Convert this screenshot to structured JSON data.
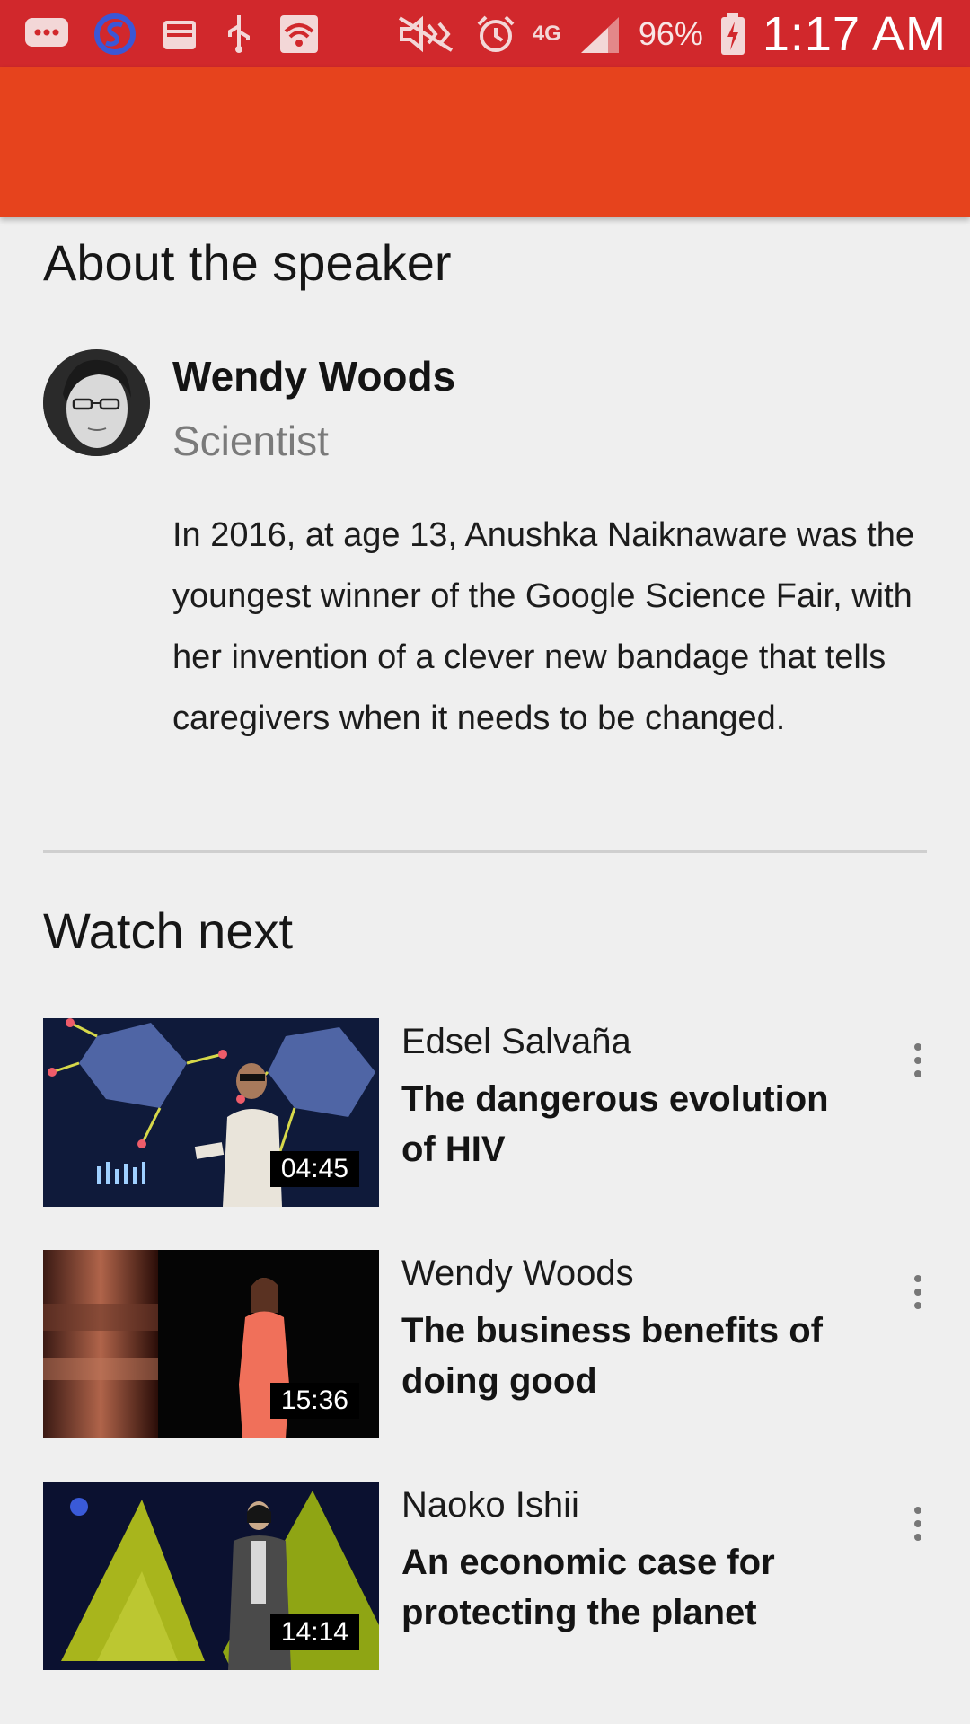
{
  "status_bar": {
    "network": "4G",
    "battery_percent": "96%",
    "time": "1:17 AM",
    "icons": [
      "message-icon",
      "s-app-icon",
      "inbox-icon",
      "usb-icon",
      "wifi-icon",
      "mute-icon",
      "alarm-icon",
      "signal-icon",
      "battery-charging-icon"
    ]
  },
  "about": {
    "heading": "About the speaker",
    "speaker_name": "Wendy Woods",
    "speaker_title": "Scientist",
    "bio": "In 2016, at age 13, Anushka Naiknaware was the youngest winner of the Google Science Fair, with her invention of a clever new bandage that tells caregivers when it needs to be changed."
  },
  "watch_next": {
    "heading": "Watch next",
    "items": [
      {
        "speaker": "Edsel Salvaña",
        "title": "The dangerous evolution of HIV",
        "duration": "04:45"
      },
      {
        "speaker": "Wendy Woods",
        "title": "The business benefits of doing good",
        "duration": "15:36"
      },
      {
        "speaker": "Naoko Ishii",
        "title": "An economic case for protecting the planet",
        "duration": "14:14"
      }
    ]
  },
  "colors": {
    "status_bar": "#d1282c",
    "app_bar": "#e6431d",
    "background": "#efefef"
  }
}
